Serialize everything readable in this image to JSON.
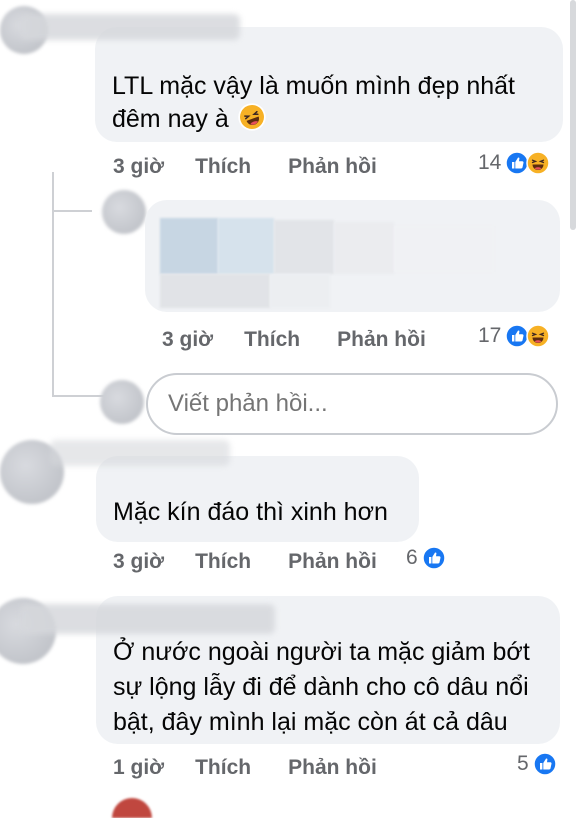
{
  "colors": {
    "like_blue": "#1877f2",
    "haha_yellow": "#f7b125",
    "bubble_bg": "#f0f2f5",
    "meta_gray": "#65676b"
  },
  "comments": [
    {
      "text_lines": [
        "LTL mặc vậy là muốn mình đẹp nhất",
        "đêm nay à"
      ],
      "inline_emoji": "rolling-laughing-emoji",
      "time": "3 giờ",
      "like_label": "Thích",
      "reply_label": "Phản hồi",
      "reaction_count": "14",
      "reactions": [
        "like-icon",
        "haha-icon"
      ]
    },
    {
      "text_lines": [],
      "time": "3 giờ",
      "like_label": "Thích",
      "reply_label": "Phản hồi",
      "reaction_count": "17",
      "reactions": [
        "like-icon",
        "haha-icon"
      ]
    },
    {
      "text_lines": [
        "Mặc kín đáo thì xinh hơn"
      ],
      "time": "3 giờ",
      "like_label": "Thích",
      "reply_label": "Phản hồi",
      "reaction_count": "6",
      "reactions": [
        "like-icon"
      ]
    },
    {
      "text_lines": [
        "Ở nước ngoài người ta mặc giảm bớt",
        "sự lộng lẫy đi để dành cho cô dâu nổi",
        "bật, đây mình lại mặc còn át cả dâu"
      ],
      "time": "1 giờ",
      "like_label": "Thích",
      "reply_label": "Phản hồi",
      "reaction_count": "5",
      "reactions": [
        "like-icon"
      ]
    }
  ],
  "reply_box": {
    "placeholder": "Viết phản hồi..."
  }
}
